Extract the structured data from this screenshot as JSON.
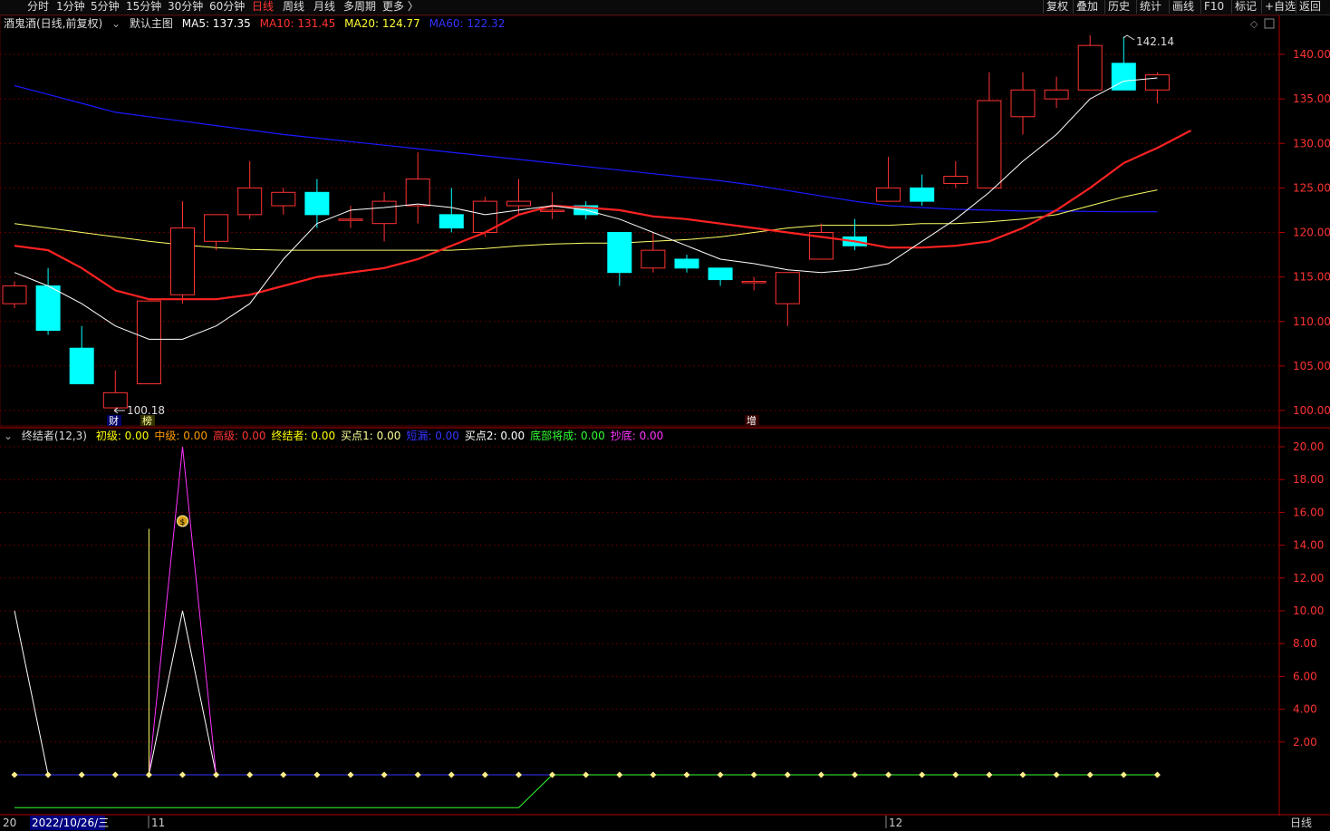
{
  "toolbar": {
    "periods": [
      "分时",
      "1分钟",
      "5分钟",
      "15分钟",
      "30分钟",
      "60分钟",
      "日线",
      "周线",
      "月线",
      "多周期",
      "更多 〉"
    ],
    "active_period": "日线",
    "right_buttons": [
      "复权",
      "叠加",
      "历史",
      "统计",
      "画线",
      "F10",
      "标记",
      "+自选",
      "返回"
    ]
  },
  "main_legend": {
    "stock": "酒鬼酒(日线,前复权)",
    "template": "默认主图",
    "ma5": "MA5: 137.35",
    "ma10": "MA10: 131.45",
    "ma20": "MA20: 124.77",
    "ma60": "MA60: 122.32"
  },
  "sub_legend": {
    "indicator": "终结者(12,3)",
    "items": [
      {
        "text": "初级: 0.00",
        "color": "#ffff00"
      },
      {
        "text": "中级: 0.00",
        "color": "#ff9900"
      },
      {
        "text": "高级: 0.00",
        "color": "#ff3333"
      },
      {
        "text": "终结者: 0.00",
        "color": "#ffff00"
      },
      {
        "text": "买点1: 0.00",
        "color": "#ffff99"
      },
      {
        "text": "短漏: 0.00",
        "color": "#3333ff"
      },
      {
        "text": "买点2: 0.00",
        "color": "#ffffff"
      },
      {
        "text": "底部将成: 0.00",
        "color": "#33ff33"
      },
      {
        "text": "抄底: 0.00",
        "color": "#ff33ff"
      }
    ]
  },
  "annotations": {
    "high_label": "142.14",
    "low_label": "100.18",
    "tag_cai": "财",
    "tag_bang": "榜",
    "tag_zeng": "增"
  },
  "bottom_axis": {
    "left_label": "20",
    "date_label": "2022/10/26/三",
    "month_11": "11",
    "month_12": "12",
    "period_label": "日线"
  },
  "colors": {
    "up": "#ff3333",
    "down": "#00ffff",
    "ma5": "#ffffff",
    "ma10": "#ff2222",
    "ma20": "#ffff66",
    "ma60": "#1a1aff",
    "grid": "#5a0000"
  },
  "chart_data": [
    {
      "type": "candlestick",
      "title": "",
      "ylim": [
        99,
        142.5
      ],
      "yticks": [
        100,
        105,
        110,
        115,
        120,
        125,
        130,
        135,
        140
      ],
      "candles": [
        {
          "o": 112,
          "h": 114.5,
          "l": 111.5,
          "c": 114
        },
        {
          "o": 114,
          "h": 116,
          "l": 108.5,
          "c": 109
        },
        {
          "o": 107,
          "h": 109.5,
          "l": 103,
          "c": 103
        },
        {
          "o": 100.3,
          "h": 104.5,
          "l": 100.18,
          "c": 102
        },
        {
          "o": 103,
          "h": 112.3,
          "l": 103,
          "c": 112.3
        },
        {
          "o": 113,
          "h": 123.5,
          "l": 112,
          "c": 120.5
        },
        {
          "o": 119,
          "h": 122,
          "l": 118,
          "c": 122
        },
        {
          "o": 122,
          "h": 128,
          "l": 121.5,
          "c": 125
        },
        {
          "o": 123,
          "h": 125,
          "l": 122,
          "c": 124.5
        },
        {
          "o": 124.5,
          "h": 126,
          "l": 120.5,
          "c": 122
        },
        {
          "o": 121.5,
          "h": 123,
          "l": 120.5,
          "c": 121.5
        },
        {
          "o": 121,
          "h": 124.5,
          "l": 119,
          "c": 123.5
        },
        {
          "o": 123,
          "h": 129,
          "l": 121,
          "c": 126
        },
        {
          "o": 122,
          "h": 125,
          "l": 120,
          "c": 120.5
        },
        {
          "o": 120,
          "h": 124,
          "l": 119.5,
          "c": 123.5
        },
        {
          "o": 123,
          "h": 126,
          "l": 122,
          "c": 123.5
        },
        {
          "o": 122.5,
          "h": 124.5,
          "l": 121.5,
          "c": 122.5
        },
        {
          "o": 123,
          "h": 123.5,
          "l": 121.5,
          "c": 122
        },
        {
          "o": 120,
          "h": 120,
          "l": 114,
          "c": 115.5
        },
        {
          "o": 116,
          "h": 120,
          "l": 115.5,
          "c": 118
        },
        {
          "o": 117,
          "h": 117.5,
          "l": 115.5,
          "c": 116
        },
        {
          "o": 116,
          "h": 116,
          "l": 114,
          "c": 114.7
        },
        {
          "o": 114.5,
          "h": 115,
          "l": 113.5,
          "c": 114.5
        },
        {
          "o": 112,
          "h": 115.5,
          "l": 109.5,
          "c": 115.5
        },
        {
          "o": 117,
          "h": 121,
          "l": 117,
          "c": 120
        },
        {
          "o": 119.5,
          "h": 121.5,
          "l": 118,
          "c": 118.5
        },
        {
          "o": 123.5,
          "h": 128.5,
          "l": 123.5,
          "c": 125
        },
        {
          "o": 125,
          "h": 126.5,
          "l": 123,
          "c": 123.5
        },
        {
          "o": 125.5,
          "h": 128,
          "l": 125,
          "c": 126.3
        },
        {
          "o": 125,
          "h": 138,
          "l": 125,
          "c": 134.8
        },
        {
          "o": 133,
          "h": 138,
          "l": 131,
          "c": 136
        },
        {
          "o": 135,
          "h": 137.5,
          "l": 134,
          "c": 136
        },
        {
          "o": 136,
          "h": 142.14,
          "l": 136,
          "c": 141
        },
        {
          "o": 139,
          "h": 142,
          "l": 136,
          "c": 136
        },
        {
          "o": 136,
          "h": 138,
          "l": 134.5,
          "c": 137.7
        }
      ],
      "ma5": [
        115.5,
        114,
        112,
        109.5,
        108,
        108,
        109.5,
        112,
        117,
        121,
        122.5,
        122.8,
        123.2,
        122.8,
        122,
        122.5,
        123,
        122.5,
        121.5,
        120,
        118.5,
        117,
        116.5,
        115.8,
        115.5,
        115.8,
        116.5,
        119,
        121.5,
        124.5,
        128,
        131,
        135,
        137,
        137.35
      ],
      "ma10": [
        118.5,
        118,
        116,
        113.5,
        112.5,
        112.5,
        112.5,
        113,
        114,
        115,
        115.5,
        116,
        117,
        118.5,
        120,
        122,
        123,
        122.8,
        122.5,
        121.8,
        121.5,
        121,
        120.5,
        120,
        119.5,
        119,
        118.3,
        118.3,
        118.5,
        119,
        120.5,
        122.5,
        125,
        127.8,
        129.5,
        131.45
      ],
      "ma20": [
        121,
        120.5,
        120,
        119.5,
        119,
        118.6,
        118.3,
        118.1,
        118,
        118,
        118,
        118,
        118,
        118,
        118.2,
        118.5,
        118.7,
        118.8,
        118.8,
        119,
        119.2,
        119.5,
        120,
        120.5,
        120.8,
        120.8,
        120.8,
        121,
        121,
        121.2,
        121.5,
        122,
        123,
        124,
        124.77
      ],
      "ma60": [
        136.5,
        135.5,
        134.5,
        133.5,
        133,
        132.5,
        132,
        131.5,
        131,
        130.6,
        130.2,
        129.8,
        129.4,
        129,
        128.6,
        128.2,
        127.8,
        127.4,
        127,
        126.6,
        126.2,
        125.8,
        125.3,
        124.7,
        124.1,
        123.5,
        123,
        122.8,
        122.6,
        122.5,
        122.4,
        122.4,
        122.35,
        122.32,
        122.32
      ]
    },
    {
      "type": "line",
      "title": "",
      "ylim": [
        0,
        21
      ],
      "yticks": [
        2,
        4,
        6,
        8,
        10,
        12,
        14,
        16,
        18,
        20
      ],
      "series": [
        {
          "name": "买点2",
          "color": "#ffffff",
          "values": [
            10,
            0,
            0,
            0,
            0,
            10,
            0,
            0,
            0,
            0,
            0,
            0,
            0,
            0,
            0,
            0,
            0,
            0,
            0,
            0,
            0,
            0,
            0,
            0,
            0,
            0,
            0,
            0,
            0,
            0,
            0,
            0,
            0,
            0,
            0
          ]
        },
        {
          "name": "抄底",
          "color": "#ff33ff",
          "values": [
            0,
            0,
            0,
            0,
            0,
            20,
            0,
            0,
            0,
            0,
            0,
            0,
            0,
            0,
            0,
            0,
            0,
            0,
            0,
            0,
            0,
            0,
            0,
            0,
            0,
            0,
            0,
            0,
            0,
            0,
            0,
            0,
            0,
            0,
            0
          ]
        },
        {
          "name": "短漏",
          "color": "#3333ff",
          "values": [
            0,
            0,
            0,
            0,
            0,
            0,
            0,
            0,
            0,
            0,
            0,
            0,
            0,
            0,
            0,
            0,
            0,
            0,
            0,
            0,
            0,
            0,
            0,
            0,
            0,
            0,
            0,
            0,
            0,
            0,
            0,
            0,
            0,
            0,
            0
          ]
        },
        {
          "name": "底部将成",
          "color": "#33ff33",
          "values": [
            -2,
            -2,
            -2,
            -2,
            -2,
            -2,
            -2,
            -2,
            -2,
            -2,
            -2,
            -2,
            -2,
            -2,
            -2,
            -2,
            0,
            0,
            0,
            0,
            0,
            0,
            0,
            0,
            0,
            0,
            0,
            0,
            0,
            0,
            0,
            0,
            0,
            0,
            0
          ]
        }
      ],
      "spike": {
        "index": 4,
        "value": 15,
        "color": "#ffff66"
      },
      "bag_marker_index": 5
    }
  ]
}
